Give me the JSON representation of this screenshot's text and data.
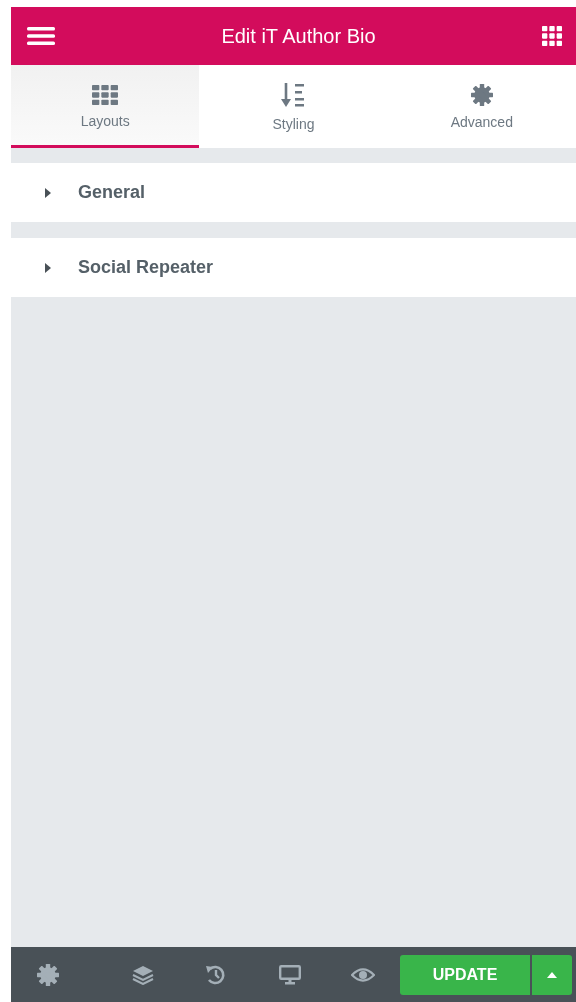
{
  "header": {
    "title": "Edit iT Author Bio"
  },
  "tabs": [
    {
      "label": "Layouts",
      "selected": true
    },
    {
      "label": "Styling",
      "selected": false
    },
    {
      "label": "Advanced",
      "selected": false
    }
  ],
  "sections": [
    {
      "label": "General",
      "expanded": false
    },
    {
      "label": "Social Repeater",
      "expanded": false
    }
  ],
  "footer": {
    "update_button": "UPDATE"
  }
}
